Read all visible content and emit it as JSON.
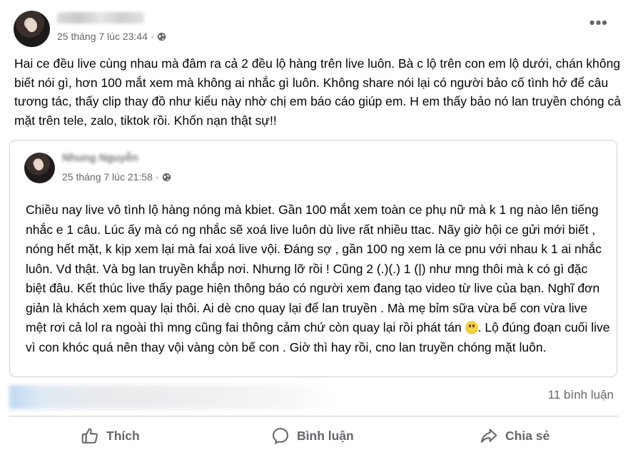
{
  "post": {
    "timestamp": "25 tháng 7 lúc 23:44",
    "more_label": "•••",
    "text": "Hai ce đều live cùng nhau mà đâm ra cả 2 đều lộ hàng trên live luôn. Bà c lộ trên con em lộ dưới, chán không biết nói gì, hơn 100 mắt xem mà không ai nhắc gì luôn. Không share nói lại có người bảo cố tình hở để câu tương tác, thấy clip thay đồ như kiểu này nhờ chị em báo cáo giúp em. H em thấy bảo nó lan truyền chóng cả mặt trên tele, zalo, tiktok rồi. Khốn nạn thật sự!!"
  },
  "shared": {
    "author_name": "Nhung Nguyễn",
    "timestamp": "25 tháng 7 lúc 21:58",
    "text_before_emoji": "Chiều nay live vô tình lộ hàng nóng mà kbiet. Gần 100 mắt xem toàn ce phụ nữ mà k 1 ng nào lên tiếng nhắc e 1 câu. Lúc ấy mà có ng nhắc sẽ xoá live luôn dù live rất nhiều ttac. Nãy giờ hội ce gửi mới biết , nóng hết mặt, k kịp xem lại mà fai xoá live vội. Đáng sợ , gần 100 ng xem là ce pnu với nhau k 1 ai nhắc luôn. Vd thật. Và bg lan truyền khắp nơi. Nhưng lỡ rồi ! Cũng 2 (.)(.) 1 (|) như mng thôi mà k có gì đặc biệt đâu. Kết thúc live thấy page hiện thông báo có người xem đang tạo video từ live của bạn. Nghĩ đơn giản là khách xem quay lại thôi. Ai dè cno quay lại để lan truyền . Mà mẹ bỉm sữa vừa bế con vừa live mệt rơi cả lol ra ngoài thì mng cũng fai thông cảm chứ còn quay lại rồi phát tán ",
    "text_after_emoji": ". Lộ đúng đoạn cuối live vì con khóc quá nên thay vội vàng còn bế con . Giờ thì hay rồi, cno lan truyền chóng mặt luôn."
  },
  "stats": {
    "comments": "11 bình luận"
  },
  "actions": {
    "like": "Thích",
    "comment": "Bình luận",
    "share": "Chia sẻ"
  }
}
